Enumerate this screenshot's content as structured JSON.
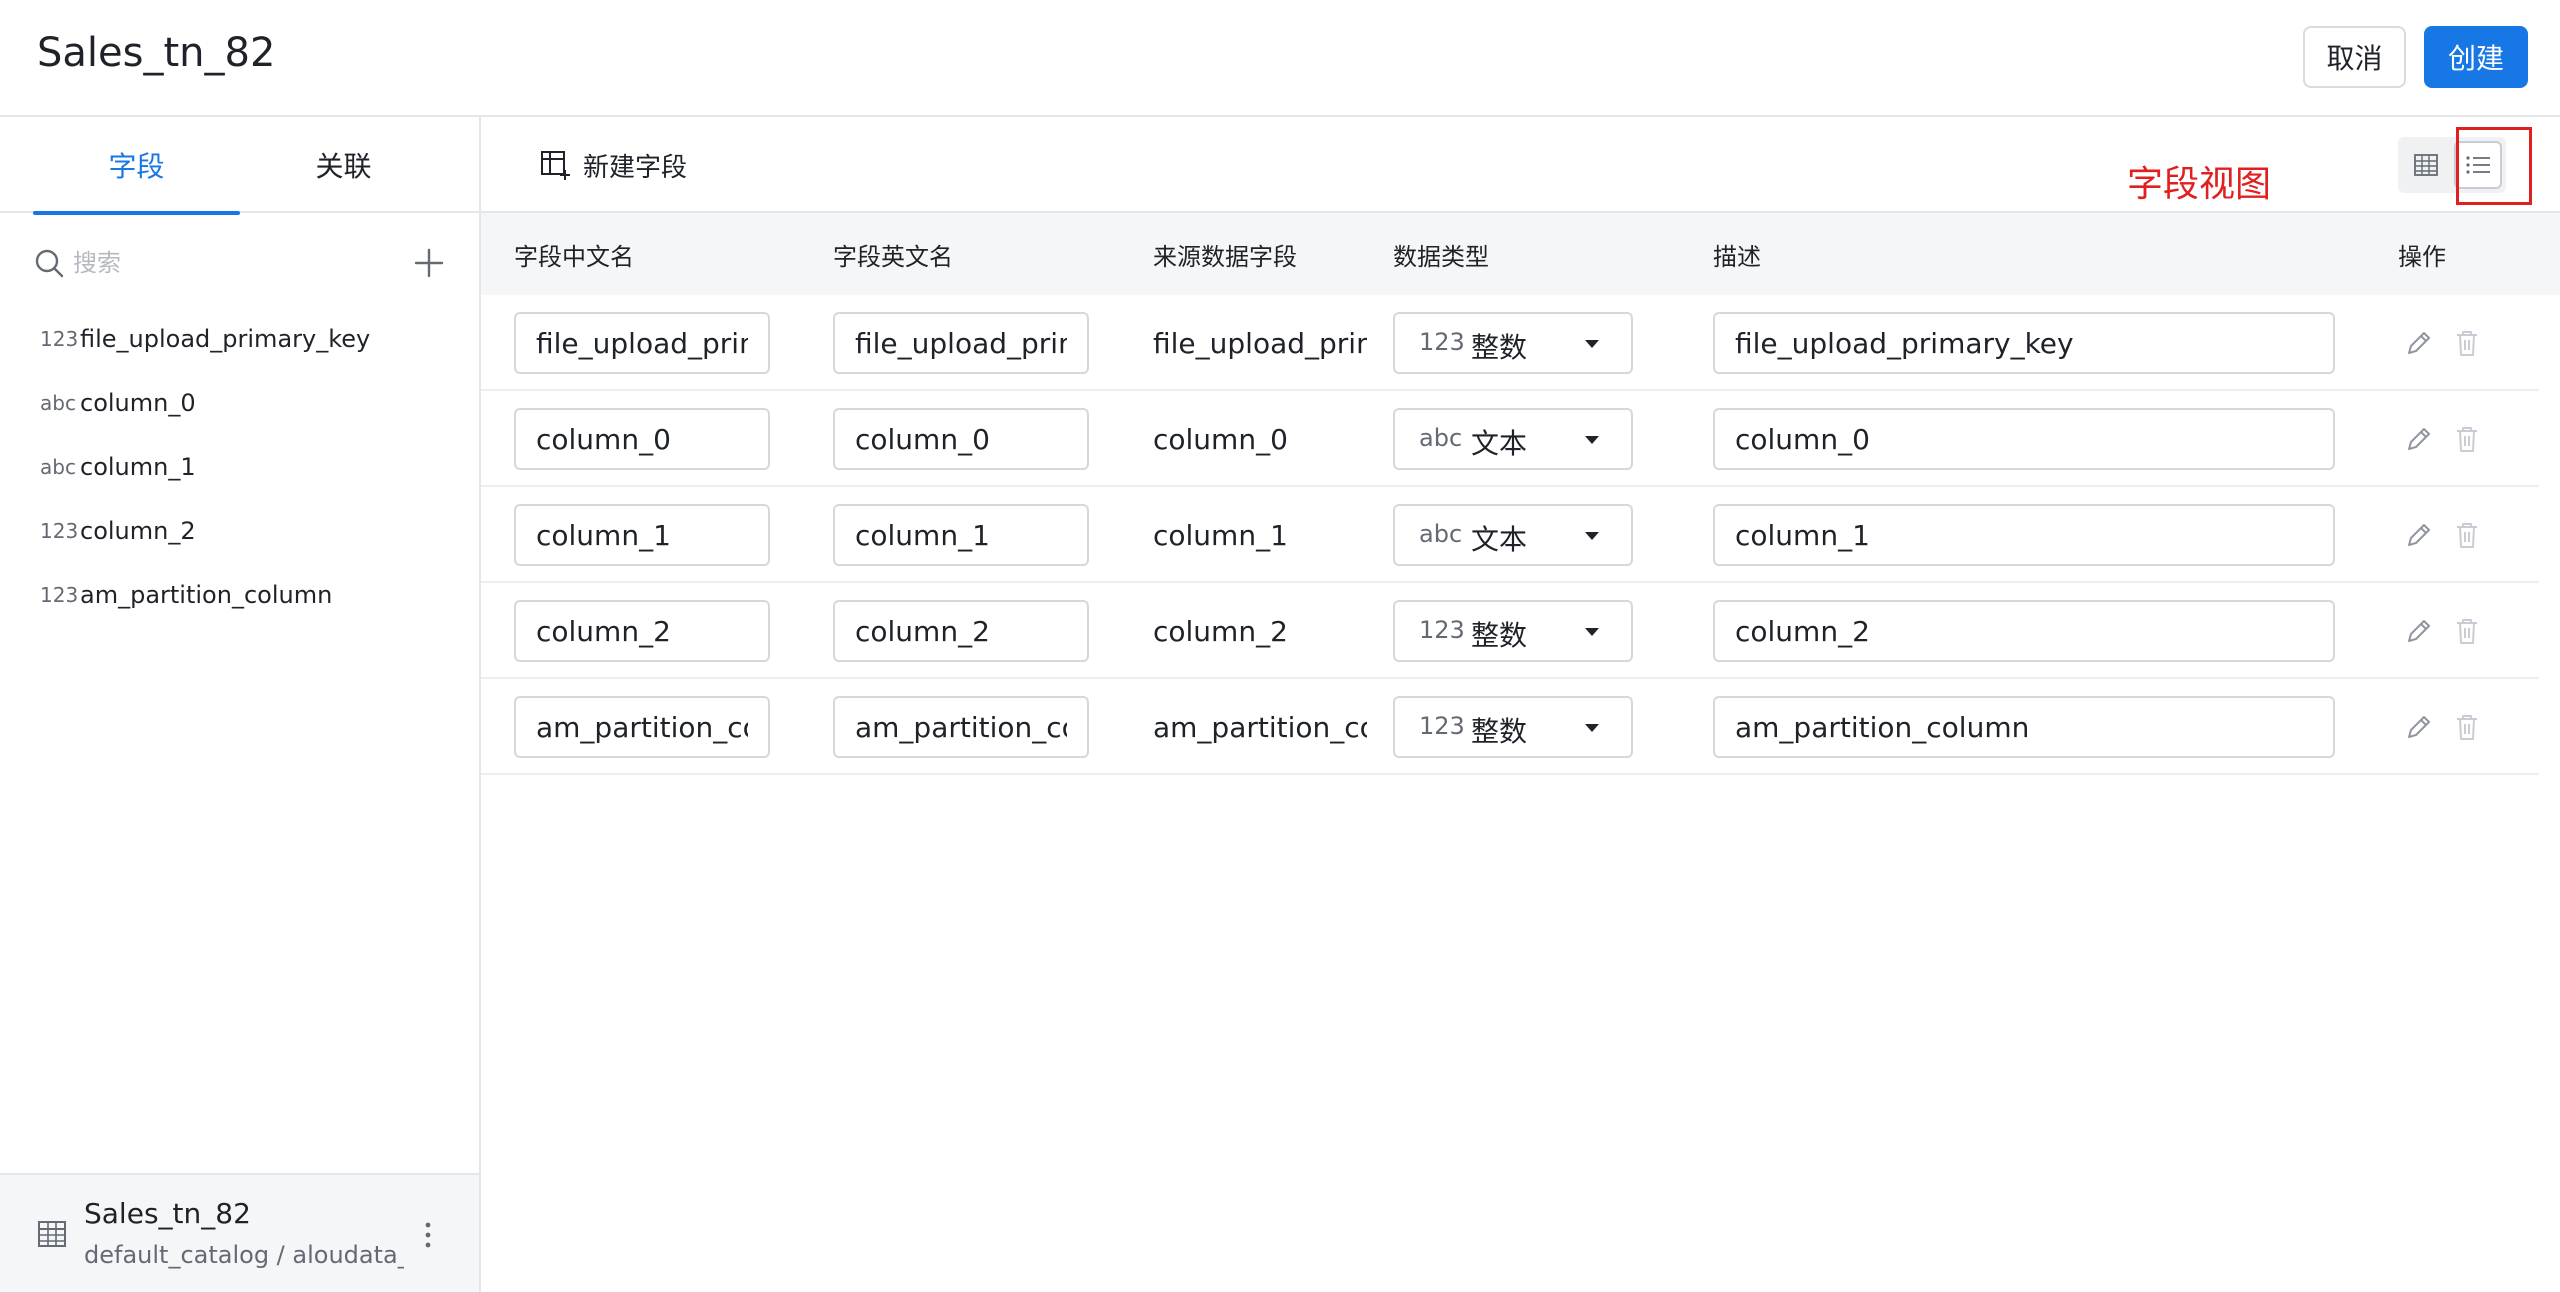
{
  "header": {
    "title": "Sales_tn_82",
    "cancel_label": "取消",
    "create_label": "创建"
  },
  "sidebar": {
    "tabs": [
      {
        "label": "字段",
        "active": true
      },
      {
        "label": "关联",
        "active": false
      }
    ],
    "search_placeholder": "搜索",
    "fields": [
      {
        "type_icon": "123",
        "name": "file_upload_primary_key"
      },
      {
        "type_icon": "abc",
        "name": "column_0"
      },
      {
        "type_icon": "abc",
        "name": "column_1"
      },
      {
        "type_icon": "123",
        "name": "column_2"
      },
      {
        "type_icon": "123",
        "name": "am_partition_column"
      }
    ],
    "footer": {
      "title": "Sales_tn_82",
      "subtitle": "default_catalog / aloudata_a"
    }
  },
  "toolbar": {
    "new_field_label": "新建字段",
    "annotation": "字段视图",
    "accent_color": "#1677e5",
    "annotation_color": "#e02020"
  },
  "table": {
    "headers": [
      "字段中文名",
      "字段英文名",
      "来源数据字段",
      "数据类型",
      "描述",
      "操作"
    ],
    "rows": [
      {
        "cn": "file_upload_primary_key",
        "en": "file_upload_primary_key",
        "source": "file_upload_primary_key",
        "type_icon": "123",
        "type_label": "整数",
        "desc": "file_upload_primary_key"
      },
      {
        "cn": "column_0",
        "en": "column_0",
        "source": "column_0",
        "type_icon": "abc",
        "type_label": "文本",
        "desc": "column_0"
      },
      {
        "cn": "column_1",
        "en": "column_1",
        "source": "column_1",
        "type_icon": "abc",
        "type_label": "文本",
        "desc": "column_1"
      },
      {
        "cn": "column_2",
        "en": "column_2",
        "source": "column_2",
        "type_icon": "123",
        "type_label": "整数",
        "desc": "column_2"
      },
      {
        "cn": "am_partition_column",
        "en": "am_partition_column",
        "source": "am_partition_column",
        "type_icon": "123",
        "type_label": "整数",
        "desc": "am_partition_column"
      }
    ]
  }
}
